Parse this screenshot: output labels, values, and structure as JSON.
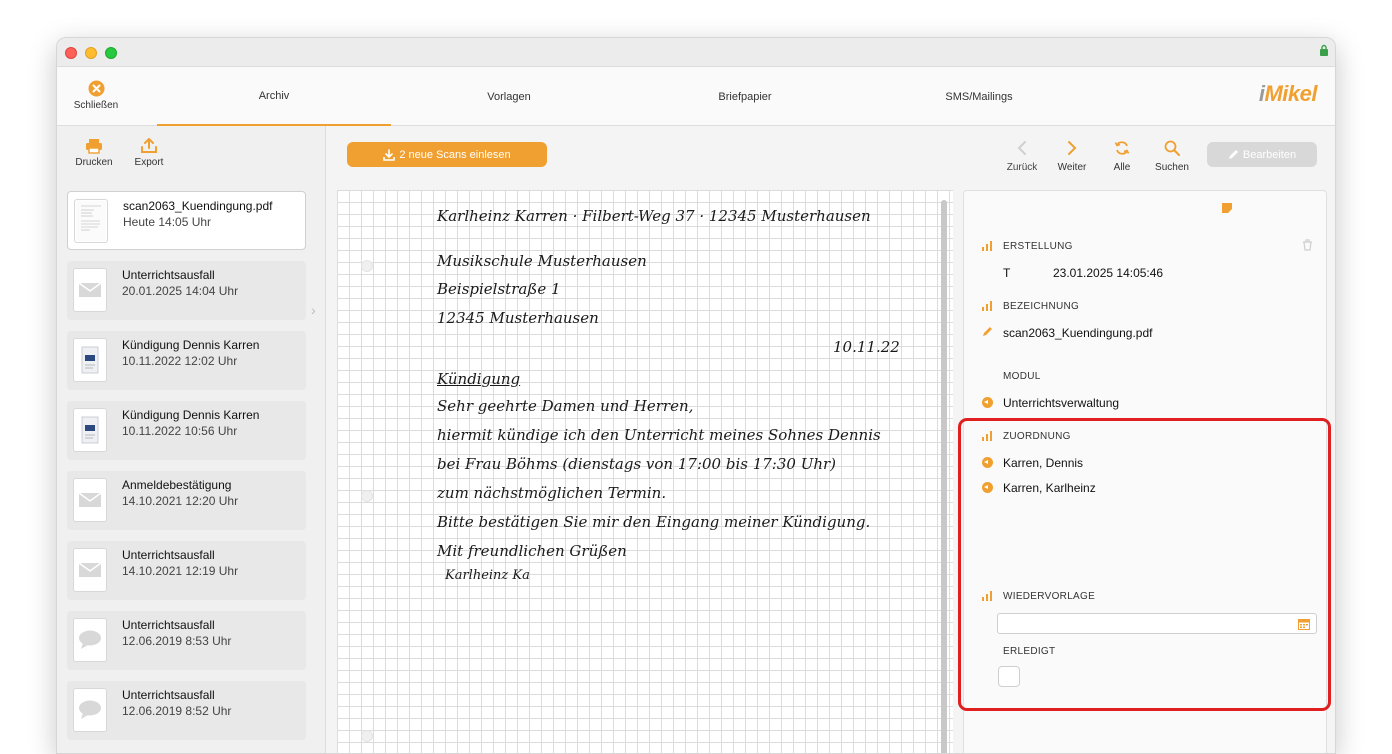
{
  "toolbar": {
    "close_label": "Schließen",
    "tabs": [
      {
        "label": "Archiv",
        "active": true
      },
      {
        "label": "Vorlagen",
        "active": false
      },
      {
        "label": "Briefpapier",
        "active": false
      },
      {
        "label": "SMS/Mailings",
        "active": false
      }
    ],
    "logo_prefix": "i",
    "logo_rest": "Mikel"
  },
  "sidebar": {
    "print_label": "Drucken",
    "export_label": "Export",
    "items": [
      {
        "title": "scan2063_Kuendingung.pdf",
        "date": "Heute 14:05 Uhr",
        "icon": "scan-thumbnail-icon"
      },
      {
        "title": "Unterrichtsausfall",
        "date": "20.01.2025 14:04 Uhr",
        "icon": "envelope-icon"
      },
      {
        "title": "Kündigung Dennis Karren",
        "date": "10.11.2022 12:02 Uhr",
        "icon": "document-icon"
      },
      {
        "title": "Kündigung Dennis Karren",
        "date": "10.11.2022 10:56 Uhr",
        "icon": "document-icon"
      },
      {
        "title": "Anmeldebestätigung",
        "date": "14.10.2021 12:20 Uhr",
        "icon": "envelope-icon"
      },
      {
        "title": "Unterrichtsausfall",
        "date": "14.10.2021 12:19 Uhr",
        "icon": "envelope-icon"
      },
      {
        "title": "Unterrichtsausfall",
        "date": "12.06.2019 8:53 Uhr",
        "icon": "speech-bubble-icon"
      },
      {
        "title": "Unterrichtsausfall",
        "date": "12.06.2019 8:52 Uhr",
        "icon": "speech-bubble-icon"
      }
    ]
  },
  "main": {
    "scan_button_label": "2 neue Scans einlesen",
    "nav": {
      "back": "Zurück",
      "next": "Weiter",
      "all": "Alle",
      "search": "Suchen"
    },
    "edit_label": "Bearbeiten"
  },
  "document": {
    "lines": [
      "Karlheinz Karren · Filbert-Weg 37 · 12345 Musterhausen",
      "Musikschule Musterhausen",
      "Beispielstraße 1",
      "12345 Musterhausen",
      "10.11.22",
      "Kündigung",
      "Sehr geehrte Damen und Herren,",
      "hiermit kündige ich den Unterricht meines Sohnes Dennis",
      "bei Frau Böhms (dienstags von 17:00 bis 17:30 Uhr)",
      "zum nächstmöglichen Termin.",
      "Bitte bestätigen Sie mir den Eingang meiner Kündigung.",
      "Mit freundlichen Grüßen",
      "Karlheinz Ka"
    ]
  },
  "details": {
    "erstellung_label": "ERSTELLUNG",
    "erstellung_user": "T",
    "erstellung_date": "23.01.2025 14:05:46",
    "bezeichnung_label": "BEZEICHNUNG",
    "bezeichnung_value": "scan2063_Kuendingung.pdf",
    "modul_label": "MODUL",
    "modul_value": "Unterrichtsverwaltung",
    "zuordnung_label": "ZUORDNUNG",
    "zuordnung_items": [
      "Karren, Dennis",
      "Karren, Karlheinz"
    ],
    "wiedervorlage_label": "WIEDERVORLAGE",
    "wiedervorlage_value": "",
    "erledigt_label": "ERLEDIGT"
  },
  "colors": {
    "accent": "#f0a030",
    "highlight": "#e02020"
  }
}
